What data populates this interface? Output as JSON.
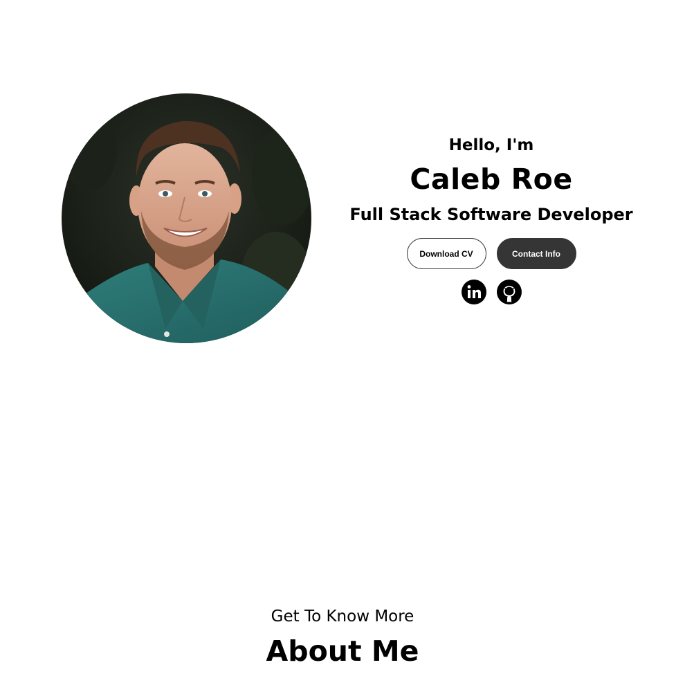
{
  "hero": {
    "greeting": "Hello, I'm",
    "name": "Caleb Roe",
    "role": "Full Stack Software Developer",
    "buttons": {
      "download_cv": "Download CV",
      "contact_info": "Contact Info"
    },
    "photo_alt": "Caleb Roe profile picture",
    "socials": [
      {
        "icon": "linkedin-icon",
        "label": "LinkedIn"
      },
      {
        "icon": "github-icon",
        "label": "GitHub"
      }
    ]
  },
  "about": {
    "subtitle": "Get To Know More",
    "title": "About Me"
  },
  "colors": {
    "button_dark": "#353535",
    "text": "#000000",
    "background": "#ffffff"
  }
}
